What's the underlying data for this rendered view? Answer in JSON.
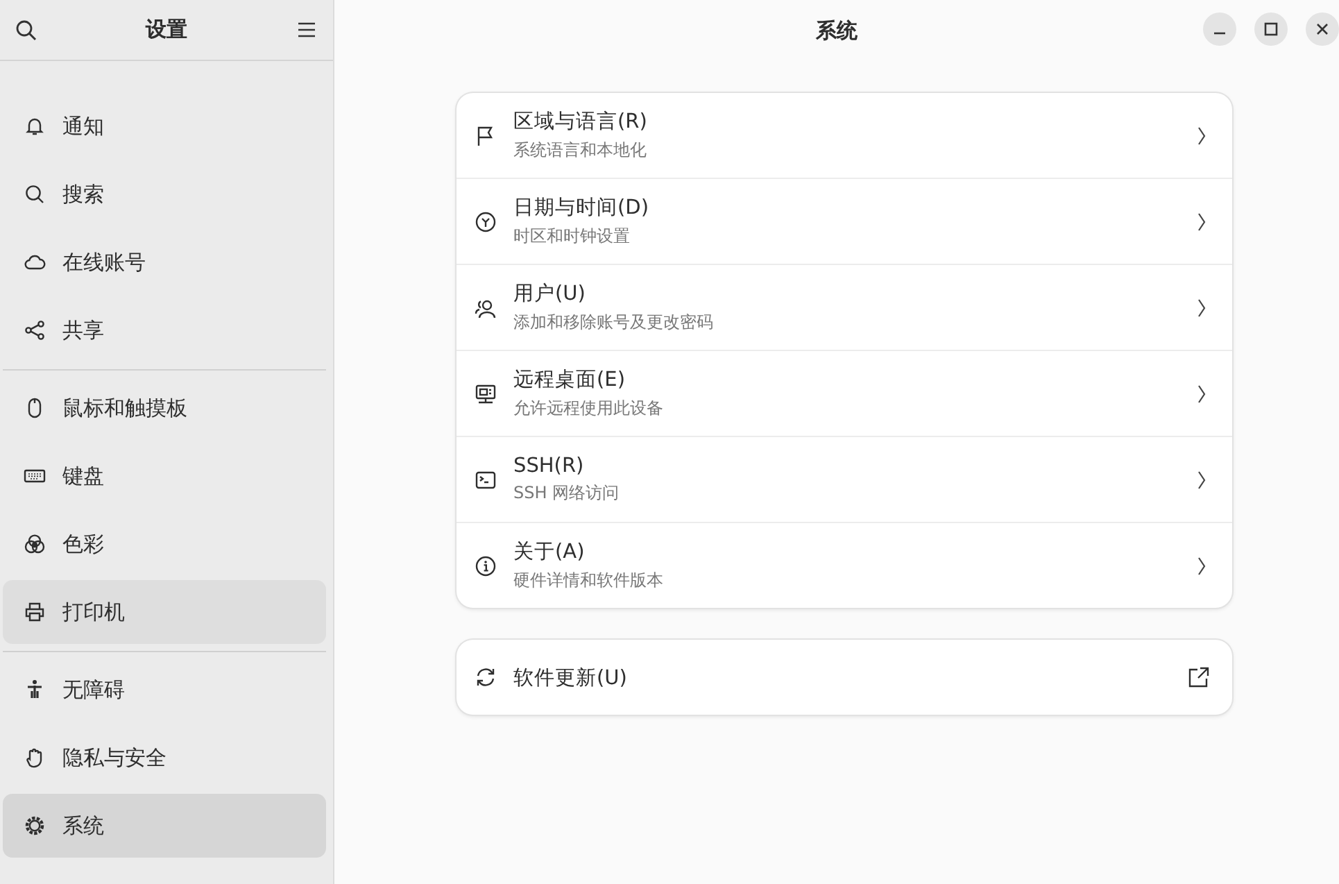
{
  "sidebar": {
    "title": "设置",
    "groups": [
      [
        {
          "label": "通知",
          "selected": false,
          "hovered": false
        },
        {
          "label": "搜索",
          "selected": false,
          "hovered": false
        },
        {
          "label": "在线账号",
          "selected": false,
          "hovered": false
        },
        {
          "label": "共享",
          "selected": false,
          "hovered": false
        }
      ],
      [
        {
          "label": "鼠标和触摸板",
          "selected": false,
          "hovered": false
        },
        {
          "label": "键盘",
          "selected": false,
          "hovered": false
        },
        {
          "label": "色彩",
          "selected": false,
          "hovered": false
        },
        {
          "label": "打印机",
          "selected": false,
          "hovered": true
        }
      ],
      [
        {
          "label": "无障碍",
          "selected": false,
          "hovered": false
        },
        {
          "label": "隐私与安全",
          "selected": false,
          "hovered": false
        },
        {
          "label": "系统",
          "selected": true,
          "hovered": false
        }
      ]
    ]
  },
  "main": {
    "title": "系统",
    "rows": [
      {
        "title": "区域与语言(R)",
        "subtitle": "系统语言和本地化"
      },
      {
        "title": "日期与时间(D)",
        "subtitle": "时区和时钟设置"
      },
      {
        "title": "用户(U)",
        "subtitle": "添加和移除账号及更改密码"
      },
      {
        "title": "远程桌面(E)",
        "subtitle": "允许远程使用此设备"
      },
      {
        "title": "SSH(R)",
        "subtitle": "SSH 网络访问"
      },
      {
        "title": "关于(A)",
        "subtitle": "硬件详情和软件版本"
      }
    ],
    "update": {
      "title": "软件更新(U)"
    }
  }
}
